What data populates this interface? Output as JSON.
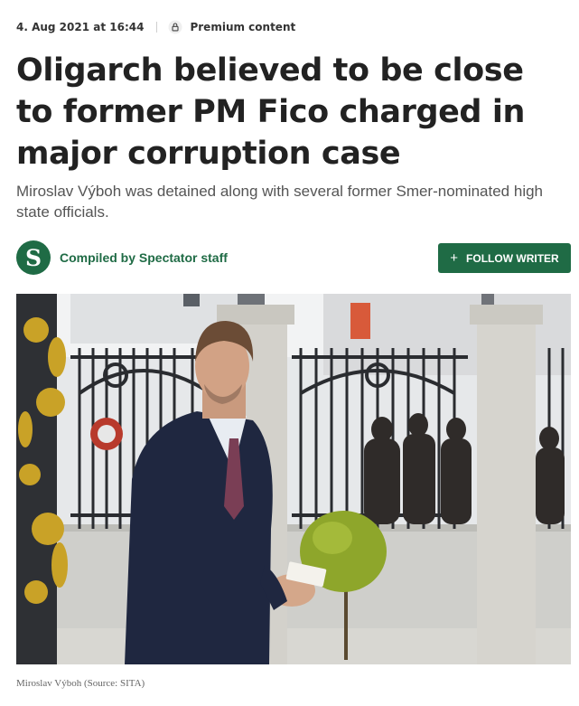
{
  "meta": {
    "date": "4. Aug 2021 at 16:44",
    "badge": "Premium content",
    "lock_icon": "lock-icon"
  },
  "article": {
    "headline": "Oligarch believed to be close to former PM Fico charged in major corruption case",
    "perex": "Miroslav Výboh was detained along with several former Smer-nominated high state officials."
  },
  "author": {
    "avatar_letter": "S",
    "name": "Compiled by Spectator staff"
  },
  "follow": {
    "icon": "+",
    "label": "FOLLOW WRITER"
  },
  "photo": {
    "caption": "Miroslav Výboh (Source: SITA)"
  },
  "colors": {
    "brand_green": "#1f6b45",
    "headline": "#222222",
    "perex": "#555555"
  }
}
